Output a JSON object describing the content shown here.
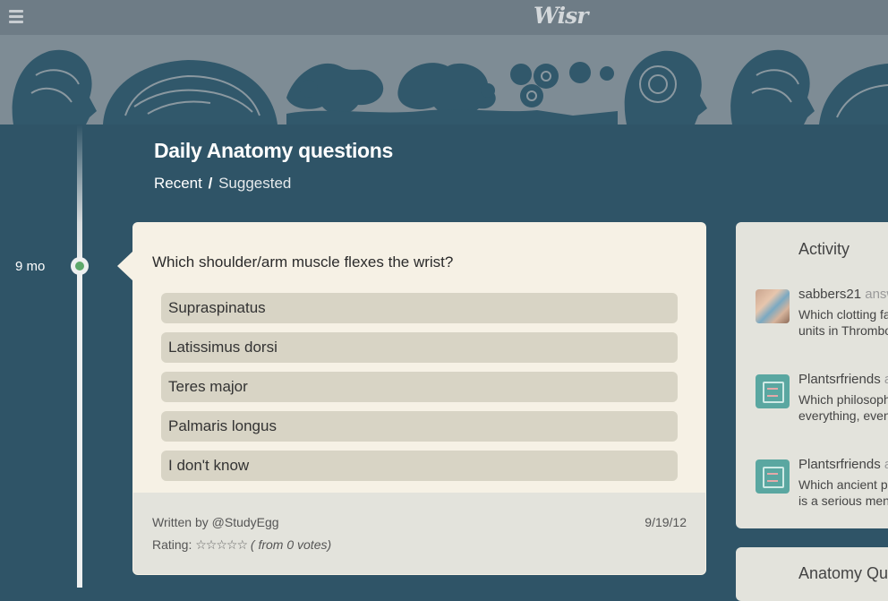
{
  "app": {
    "logo": "Wisr"
  },
  "header": {
    "title": "Daily Anatomy questions",
    "filter_active": "Recent",
    "filter_sep": "/",
    "filter_inactive": "Suggested"
  },
  "timeline": {
    "age": "9 mo"
  },
  "question": {
    "text": "Which shoulder/arm muscle flexes the wrist?",
    "answers": [
      "Supraspinatus",
      "Latissimus dorsi",
      "Teres major",
      "Palmaris longus",
      "I don't know"
    ],
    "author": "Written by @StudyEgg",
    "date": "9/19/12",
    "rating_label": "Rating:",
    "stars": "☆☆☆☆☆",
    "votes": "( from 0 votes)"
  },
  "activity": {
    "title": "Activity",
    "items": [
      {
        "user": "sabbers21",
        "verb": "answ",
        "line1": "Which clotting fa",
        "line2": "units in Thrombo",
        "avatar": "photo"
      },
      {
        "user": "Plantsrfriends",
        "verb": "a",
        "line1": "Which philosoph",
        "line2": "everything, even",
        "avatar": "plant"
      },
      {
        "user": "Plantsrfriends",
        "verb": "a",
        "line1": "Which ancient p",
        "line2": "is a serious men",
        "avatar": "plant"
      }
    ]
  },
  "quiz_panel": {
    "title": "Anatomy Qui"
  },
  "colors": {
    "background": "#2f5467",
    "topbar": "#6e7c86",
    "banner": "#7e8c95",
    "card": "#f6f1e5",
    "answer": "#d8d4c5",
    "accent_dot": "#5ea86b"
  },
  "icons": {
    "menu": "hamburger-menu-icon"
  }
}
